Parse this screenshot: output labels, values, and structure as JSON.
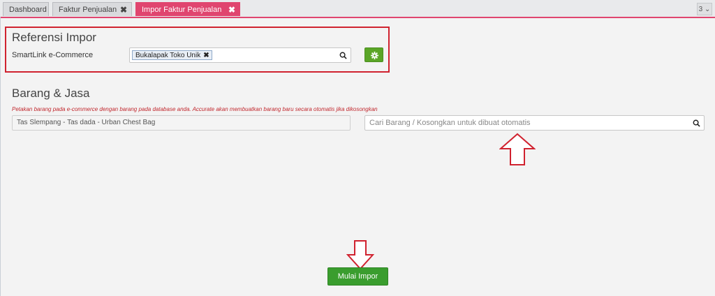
{
  "tabs": [
    {
      "label": "Dashboard",
      "closable": false,
      "active": false
    },
    {
      "label": "Faktur Penjualan",
      "closable": true,
      "active": false
    },
    {
      "label": "Impor Faktur Penjualan",
      "closable": true,
      "active": true
    }
  ],
  "tab_close_glyph": "✖",
  "tab_count": "3 ⌄",
  "reference": {
    "title": "Referensi Impor",
    "label": "SmartLink e-Commerce",
    "selected_chip": "Bukalapak Toko Unik",
    "chip_remove_glyph": "✖"
  },
  "goods": {
    "title": "Barang & Jasa",
    "note": "Petakan barang pada e-commerce dengan barang pada database anda. Accurate akan membuatkan barang baru secara otomatis jika dikosongkan",
    "item_name": "Tas Slempang - Tas dada - Urban Chest Bag",
    "search_placeholder": "Cari Barang / Kosongkan untuk dibuat otomatis"
  },
  "start_button_label": "Mulai Impor",
  "icons": {
    "search": "search-icon",
    "settings": "gear-icon",
    "annotation": "arrow-annotation-icon"
  },
  "colors": {
    "active_tab": "#e0456f",
    "annotation_red": "#d0222f",
    "primary_green": "#3a9d2e",
    "note_red": "#c1272d"
  }
}
